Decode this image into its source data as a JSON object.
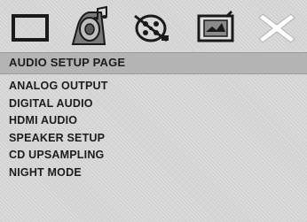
{
  "tabs": [
    {
      "id": "general",
      "icon": "general-setup-icon"
    },
    {
      "id": "audio",
      "icon": "audio-setup-icon",
      "selected": true
    },
    {
      "id": "video",
      "icon": "video-setup-icon"
    },
    {
      "id": "preference",
      "icon": "preference-setup-icon"
    },
    {
      "id": "exit",
      "icon": "exit-close-icon"
    }
  ],
  "page_title": "AUDIO SETUP PAGE",
  "menu_items": [
    "ANALOG OUTPUT",
    "DIGITAL AUDIO",
    "HDMI AUDIO",
    "SPEAKER SETUP",
    "CD UPSAMPLING",
    "NIGHT MODE"
  ],
  "colors": {
    "background": "#d2d2d2",
    "header_bar": "#b4b4b4",
    "text": "#1c1c1c",
    "icon_outline": "#1a1a1a"
  }
}
